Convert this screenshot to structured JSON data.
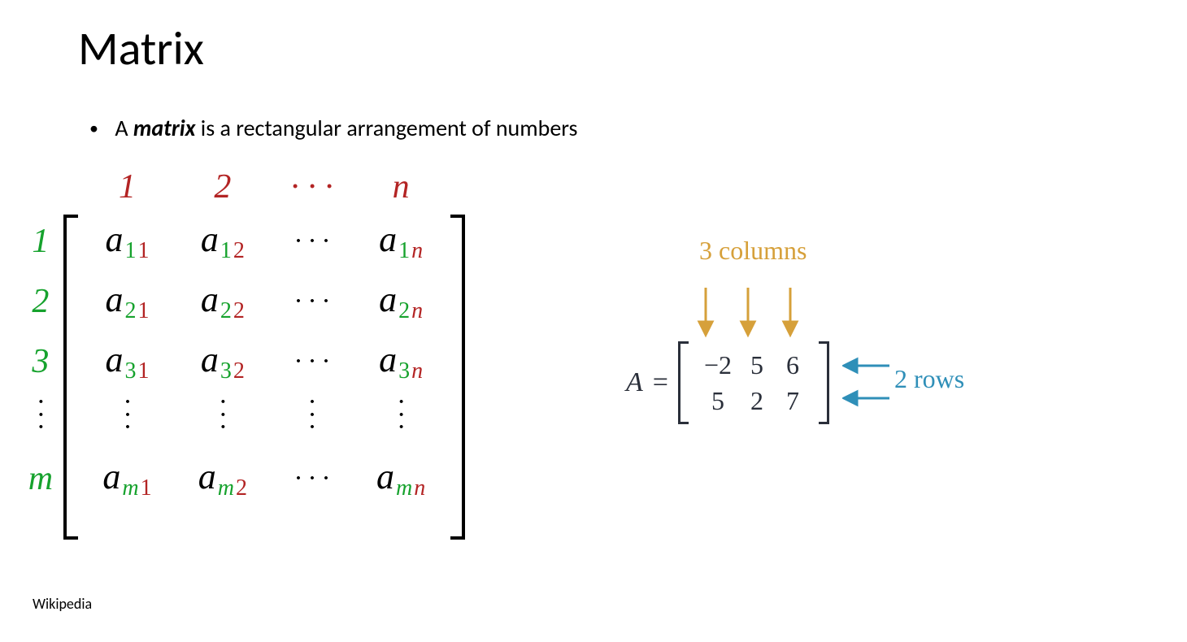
{
  "title": "Matrix",
  "bullet": {
    "lead": "A ",
    "keyword": "matrix",
    "rest": " is a rectangular arrangement of numbers"
  },
  "citation": "Wikipedia",
  "generic_matrix": {
    "col_headers": [
      "1",
      "2",
      "…",
      "n"
    ],
    "row_headers": [
      "1",
      "2",
      "3",
      "⋮",
      "m"
    ],
    "entries": [
      [
        {
          "b": "a",
          "g": "1",
          "r": "1"
        },
        {
          "b": "a",
          "g": "1",
          "r": "2"
        },
        {
          "dots": "h"
        },
        {
          "b": "a",
          "g": "1",
          "r": "n",
          "ri": true
        }
      ],
      [
        {
          "b": "a",
          "g": "2",
          "r": "1"
        },
        {
          "b": "a",
          "g": "2",
          "r": "2"
        },
        {
          "dots": "h"
        },
        {
          "b": "a",
          "g": "2",
          "r": "n",
          "ri": true
        }
      ],
      [
        {
          "b": "a",
          "g": "3",
          "r": "1"
        },
        {
          "b": "a",
          "g": "3",
          "r": "2"
        },
        {
          "dots": "h"
        },
        {
          "b": "a",
          "g": "3",
          "r": "n",
          "ri": true
        }
      ],
      [
        {
          "dots": "v"
        },
        {
          "dots": "v"
        },
        {
          "dots": "v"
        },
        {
          "dots": "v"
        }
      ],
      [
        {
          "b": "a",
          "g": "m",
          "gi": true,
          "r": "1"
        },
        {
          "b": "a",
          "g": "m",
          "gi": true,
          "r": "2"
        },
        {
          "dots": "h"
        },
        {
          "b": "a",
          "g": "m",
          "gi": true,
          "r": "n",
          "ri": true
        }
      ]
    ]
  },
  "example": {
    "name": "A",
    "cols_label": "3 columns",
    "rows_label": "2 rows",
    "values": [
      [
        "−2",
        "5",
        "6"
      ],
      [
        "5",
        "2",
        "7"
      ]
    ],
    "colors": {
      "cols": "#d6a03a",
      "rows": "#2f8fb8",
      "ink": "#2a2f3a"
    }
  }
}
